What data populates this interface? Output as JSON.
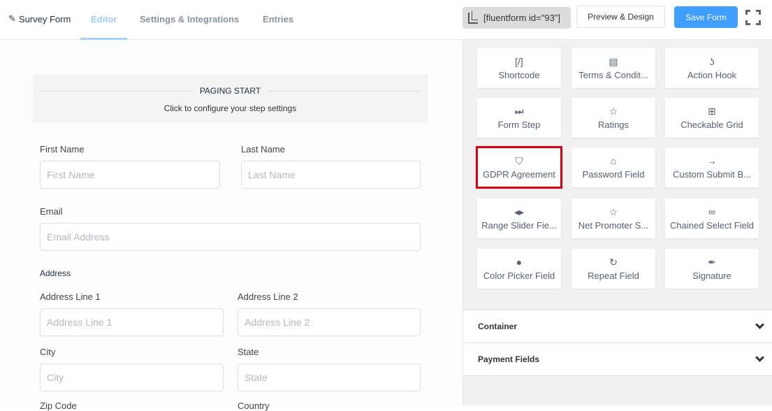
{
  "header": {
    "brand_icon": "pencil-icon",
    "form_name": "Survey Form",
    "tabs": [
      {
        "label": "Editor",
        "active": true
      },
      {
        "label": "Settings & Integrations",
        "active": false
      },
      {
        "label": "Entries",
        "active": false
      }
    ],
    "shortcode_icon": "copy-icon",
    "shortcode": "[fluentform id=\"93\"]",
    "preview_label": "Preview & Design",
    "save_label": "Save Form",
    "fullscreen_icon": "fullscreen-icon",
    "accent_color": "#409eff"
  },
  "editor": {
    "paging": {
      "title": "PAGING START",
      "subtitle": "Click to configure your step settings"
    },
    "fields": {
      "first_name": {
        "label": "First Name",
        "placeholder": "First Name"
      },
      "last_name": {
        "label": "Last Name",
        "placeholder": "Last Name"
      },
      "email": {
        "label": "Email",
        "placeholder": "Email Address"
      },
      "address_heading": "Address",
      "address_line_1": {
        "label": "Address Line 1",
        "placeholder": "Address Line 1"
      },
      "address_line_2": {
        "label": "Address Line 2",
        "placeholder": "Address Line 2"
      },
      "city": {
        "label": "City",
        "placeholder": "City"
      },
      "state": {
        "label": "State",
        "placeholder": "State"
      },
      "zip": {
        "label": "Zip Code"
      },
      "country": {
        "label": "Country"
      }
    }
  },
  "sidebar": {
    "fields": [
      {
        "label": "Shortcode",
        "icon": "shortcode-icon",
        "glyph": "[/]"
      },
      {
        "label": "Terms & Condit...",
        "icon": "document-icon",
        "glyph": "▤"
      },
      {
        "label": "Action Hook",
        "icon": "hook-icon",
        "glyph": "ʖ"
      },
      {
        "label": "Form Step",
        "icon": "step-forward-icon",
        "glyph": "⏭"
      },
      {
        "label": "Ratings",
        "icon": "star-icon",
        "glyph": "☆"
      },
      {
        "label": "Checkable Grid",
        "icon": "grid-check-icon",
        "glyph": "⊞"
      },
      {
        "label": "GDPR Agreement",
        "icon": "shield-icon",
        "glyph": "⛉",
        "highlighted": true
      },
      {
        "label": "Password Field",
        "icon": "lock-icon",
        "glyph": "⌂"
      },
      {
        "label": "Custom Submit B...",
        "icon": "arrow-right-icon",
        "glyph": "→"
      },
      {
        "label": "Range Slider Fie...",
        "icon": "range-icon",
        "glyph": "◂▸"
      },
      {
        "label": "Net Promoter S...",
        "icon": "star-icon",
        "glyph": "☆"
      },
      {
        "label": "Chained Select Field",
        "icon": "link-icon",
        "glyph": "∞"
      },
      {
        "label": "Color Picker Field",
        "icon": "drop-icon",
        "glyph": "●"
      },
      {
        "label": "Repeat Field",
        "icon": "repeat-icon",
        "glyph": "↻"
      },
      {
        "label": "Signature",
        "icon": "quill-icon",
        "glyph": "✒"
      }
    ],
    "sections": [
      {
        "label": "Container",
        "icon": "chevron-down-icon"
      },
      {
        "label": "Payment Fields",
        "icon": "chevron-down-icon"
      }
    ],
    "highlight_color": "#d7000f"
  }
}
